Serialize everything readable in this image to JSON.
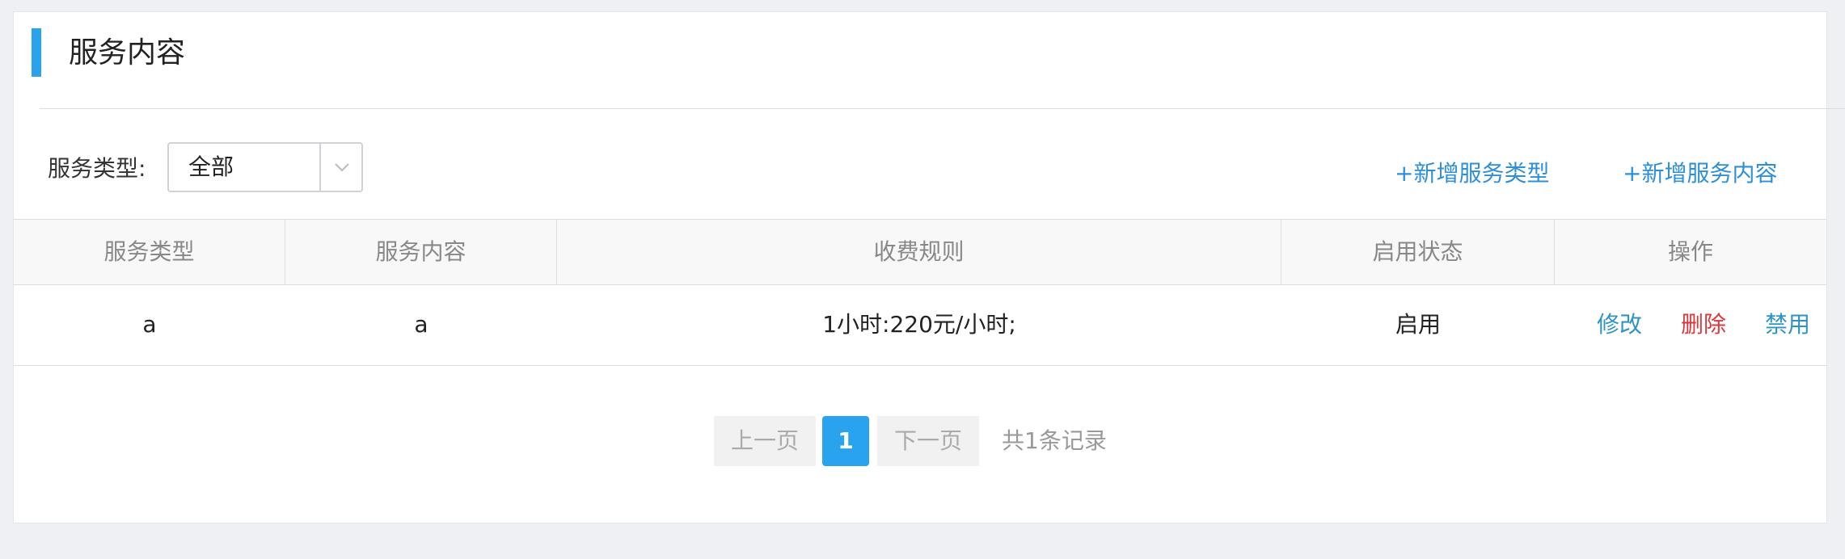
{
  "header": {
    "title": "服务内容"
  },
  "filters": {
    "type_label": "服务类型:",
    "type_value": "全部"
  },
  "actions": {
    "add_type": "+新增服务类型",
    "add_content": "+新增服务内容"
  },
  "table": {
    "columns": [
      "服务类型",
      "服务内容",
      "收费规则",
      "启用状态",
      "操作"
    ],
    "rows": [
      {
        "type": "a",
        "content": "a",
        "rule": "1小时:220元/小时;",
        "status": "启用",
        "operations": {
          "edit": "修改",
          "delete": "删除",
          "disable": "禁用"
        }
      }
    ]
  },
  "pagination": {
    "prev": "上一页",
    "current": "1",
    "next": "下一页",
    "total": "共1条记录"
  },
  "colors": {
    "accent": "#2aa3ef",
    "link": "#2d8fd8",
    "danger": "#d9383a"
  }
}
